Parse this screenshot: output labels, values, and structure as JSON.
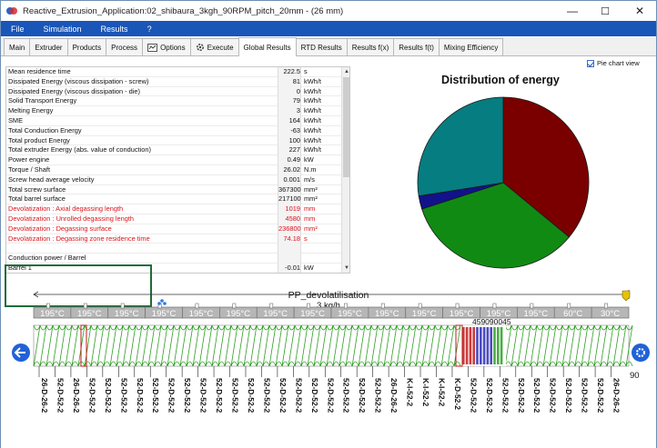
{
  "window": {
    "title": "Reactive_Extrusion_Application:02_shibaura_3kgh_90RPM_pitch_20mm - (26 mm)",
    "min_icon": "minimize-icon",
    "max_icon": "maximize-icon",
    "close_icon": "close-icon",
    "min_glyph": "—",
    "max_glyph": "☐",
    "close_glyph": "✕"
  },
  "menu": [
    "File",
    "Simulation",
    "Results",
    "?"
  ],
  "tabs": [
    {
      "label": "Main",
      "active": false
    },
    {
      "label": "Extruder",
      "active": false
    },
    {
      "label": "Products",
      "active": false
    },
    {
      "label": "Process",
      "active": false
    },
    {
      "label": "Options",
      "active": false,
      "icon": "options-icon"
    },
    {
      "label": "Execute",
      "active": false,
      "icon": "execute-icon"
    },
    {
      "label": "Global Results",
      "active": true
    },
    {
      "label": "RTD Results",
      "active": false
    },
    {
      "label": "Results f(x)",
      "active": false
    },
    {
      "label": "Results f(t)",
      "active": false
    },
    {
      "label": "Mixing Efficiency",
      "active": false
    }
  ],
  "results": [
    {
      "label": "Mean residence time",
      "value": "222.5",
      "unit": "s",
      "red": false
    },
    {
      "label": "Dissipated Energy (viscous dissipation - screw)",
      "value": "81",
      "unit": "kWh/t",
      "red": false
    },
    {
      "label": "Dissipated Energy (viscous dissipation - die)",
      "value": "0",
      "unit": "kWh/t",
      "red": false
    },
    {
      "label": "Solid Transport Energy",
      "value": "79",
      "unit": "kWh/t",
      "red": false
    },
    {
      "label": "Melting Energy",
      "value": "3",
      "unit": "kWh/t",
      "red": false
    },
    {
      "label": "SME",
      "value": "164",
      "unit": "kWh/t",
      "red": false
    },
    {
      "label": "Total Conduction Energy",
      "value": "-63",
      "unit": "kWh/t",
      "red": false
    },
    {
      "label": "Total product Energy",
      "value": "100",
      "unit": "kWh/t",
      "red": false
    },
    {
      "label": "Total extruder Energy (abs. value of conduction)",
      "value": "227",
      "unit": "kWh/t",
      "red": false
    },
    {
      "label": "Power engine",
      "value": "0.49",
      "unit": "kW",
      "red": false
    },
    {
      "label": "Torque / Shaft",
      "value": "26.02",
      "unit": "N.m",
      "red": false
    },
    {
      "label": "Screw head average velocity",
      "value": "0.001",
      "unit": "m/s",
      "red": false
    },
    {
      "label": "Total screw surface",
      "value": "367300",
      "unit": "mm²",
      "red": false
    },
    {
      "label": "Total barrel surface",
      "value": "217100",
      "unit": "mm²",
      "red": false
    },
    {
      "label": "Devolatization : Axial degassing length",
      "value": "1019",
      "unit": "mm",
      "red": true
    },
    {
      "label": "Devolatization : Unrolled degassing length",
      "value": "4580",
      "unit": "mm",
      "red": true
    },
    {
      "label": "Devolatization : Degassing surface",
      "value": "236800",
      "unit": "mm²",
      "red": true
    },
    {
      "label": "Devolatization : Degassing zone residence time",
      "value": "74.18",
      "unit": "s",
      "red": true
    },
    {
      "label": "",
      "value": "",
      "unit": "",
      "red": false
    },
    {
      "label": "Conduction power / Barrel",
      "value": "",
      "unit": "",
      "red": false
    },
    {
      "label": "Barrel 1",
      "value": "-0.01",
      "unit": "kW",
      "red": false
    }
  ],
  "pie_toggle_label": "Pie chart view",
  "chart_data": {
    "type": "pie",
    "title": "Distribution of energy",
    "values": [
      36,
      34,
      2.5,
      27.5
    ],
    "colors": [
      "#7a0000",
      "#118a14",
      "#12128a",
      "#067d80"
    ],
    "start_angle_deg": 0,
    "direction": "clockwise"
  },
  "extruder": {
    "label": "PP_devolatilisation",
    "throughput": "3 kg/h",
    "left_nav_icon": "arrow-left-icon",
    "right_icon": "settings-icon",
    "rpm": "90",
    "temps": [
      "195°C",
      "195°C",
      "195°C",
      "195°C",
      "195°C",
      "195°C",
      "195°C",
      "195°C",
      "195°C",
      "195°C",
      "195°C",
      "195°C",
      "195°C",
      "195°C",
      "60°C",
      "30°C"
    ],
    "stagger_label": "459090045",
    "elements": [
      "26-D-26-2",
      "52-D-52-2",
      "26-D-26-2",
      "52-D-52-2",
      "52-D-52-2",
      "52-D-52-2",
      "52-D-52-2",
      "52-D-52-2",
      "52-D-52-2",
      "52-D-52-2",
      "52-D-52-2",
      "52-D-52-2",
      "52-D-52-2",
      "52-D-52-2",
      "52-D-52-2",
      "52-D-52-2",
      "52-D-52-2",
      "52-D-52-2",
      "52-D-52-2",
      "52-D-52-2",
      "52-D-52-2",
      "52-D-52-2",
      "26-D-26-2",
      "K-I-52-2",
      "K-I-52-2",
      "K-I-52-2",
      "K-D-52-2",
      "52-D-52-2",
      "52-D-52-2",
      "52-D-52-2",
      "52-D-52-2",
      "52-D-52-2",
      "52-D-52-2",
      "52-D-52-2",
      "52-D-52-2",
      "52-D-52-2",
      "26-D-26-2"
    ]
  }
}
